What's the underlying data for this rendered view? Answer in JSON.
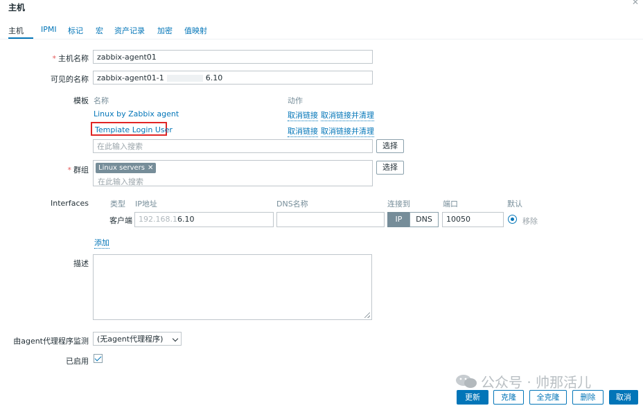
{
  "dialog": {
    "title": "主机"
  },
  "tabs": [
    {
      "label": "主机"
    },
    {
      "label": "IPMI"
    },
    {
      "label": "标记"
    },
    {
      "label": "宏"
    },
    {
      "label": "资产记录"
    },
    {
      "label": "加密"
    },
    {
      "label": "值映射"
    }
  ],
  "form": {
    "host_name": {
      "label": "主机名称",
      "value": "zabbix-agent01"
    },
    "visible_name": {
      "label": "可见的名称",
      "value": "zabbix-agent01-1",
      "value_suffix": "6.10"
    },
    "templates": {
      "label": "模板",
      "col_name": "名称",
      "col_action": "动作",
      "rows": [
        {
          "name": "Linux by Zabbix agent",
          "unlink": "取消链接",
          "unlink_clear": "取消链接并清理"
        },
        {
          "name": "Tempiate Login User",
          "unlink": "取消链接",
          "unlink_clear": "取消链接并清理"
        }
      ],
      "search_placeholder": "在此输入搜索",
      "select_btn": "选择"
    },
    "groups": {
      "label": "群组",
      "chips": [
        {
          "label": "Linux servers",
          "remove": "✕"
        }
      ],
      "search_placeholder": "在此输入搜索",
      "select_btn": "选择"
    },
    "interfaces": {
      "label": "Interfaces",
      "col_type": "类型",
      "col_ip": "IP地址",
      "col_dns": "DNS名称",
      "col_connect": "连接到",
      "col_port": "端口",
      "col_default": "默认",
      "row": {
        "type": "客户端",
        "ip_prefix": "192.168.1",
        "ip_suffix": "6.10",
        "dns": "",
        "connect_ip": "IP",
        "connect_dns": "DNS",
        "port": "10050",
        "remove": "移除"
      },
      "add": "添加"
    },
    "description": {
      "label": "描述",
      "value": ""
    },
    "proxy": {
      "label": "由agent代理程序监测",
      "value": "(无agent代理程序)"
    },
    "enabled": {
      "label": "已启用"
    }
  },
  "actions": {
    "update": "更新",
    "clone": "克隆",
    "full_clone": "全克隆",
    "delete": "删除",
    "cancel": "取消"
  },
  "watermark": {
    "text": "公众号 · 帅那活儿"
  },
  "colors": {
    "accent": "#0275b8",
    "required": "#e45959",
    "highlight": "#e02424",
    "chip": "#768d99"
  }
}
